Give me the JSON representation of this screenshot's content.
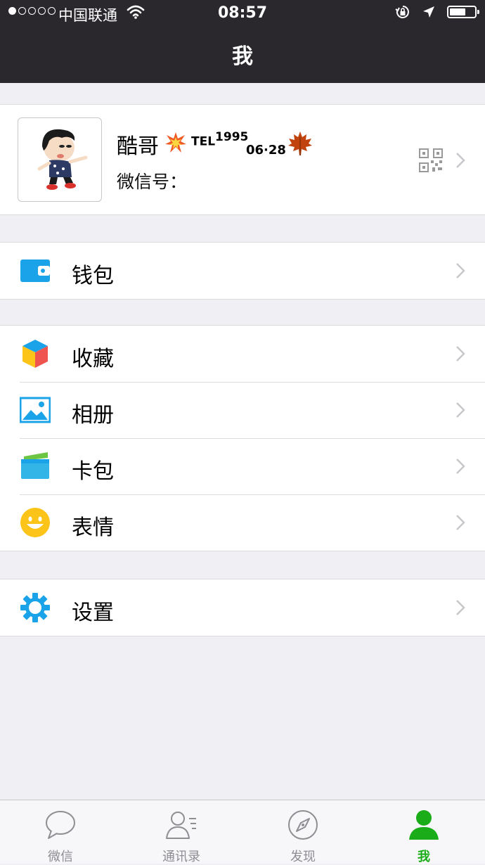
{
  "status_bar": {
    "carrier": "中国联通",
    "time": "08:57",
    "battery_level": 0.65
  },
  "header": {
    "title": "我"
  },
  "profile": {
    "name": "酷哥",
    "tel_label": "TEL",
    "tel_number": "1995",
    "date": "06·28",
    "wechat_id_label": "微信号："
  },
  "menu": {
    "wallet": {
      "label": "钱包",
      "icon": "wallet-icon"
    },
    "favorites": {
      "label": "收藏",
      "icon": "cube-icon"
    },
    "album": {
      "label": "相册",
      "icon": "picture-icon"
    },
    "card_pack": {
      "label": "卡包",
      "icon": "card-pack-icon"
    },
    "stickers": {
      "label": "表情",
      "icon": "smiley-icon"
    },
    "settings": {
      "label": "设置",
      "icon": "gear-icon"
    }
  },
  "tabbar": {
    "tabs": [
      {
        "label": "微信",
        "icon": "chat-bubble-icon",
        "active": false
      },
      {
        "label": "通讯录",
        "icon": "contacts-icon",
        "active": false
      },
      {
        "label": "发现",
        "icon": "compass-icon",
        "active": false
      },
      {
        "label": "我",
        "icon": "person-icon",
        "active": true
      }
    ]
  },
  "colors": {
    "header_bg": "#2a282d",
    "page_bg": "#efeff4",
    "active_tab": "#1aad19",
    "inactive_tab": "#8e8e93",
    "icon_blue": "#1aa3e8"
  }
}
